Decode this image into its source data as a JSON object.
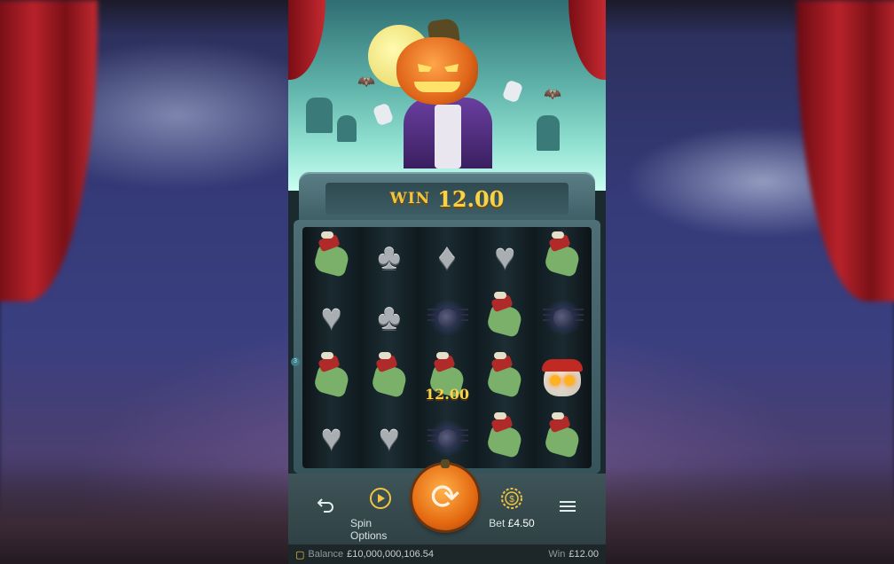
{
  "hud": {
    "win_label": "WIN",
    "win_amount": "12.00"
  },
  "reels": {
    "rows": [
      [
        "zombie-hand",
        "club",
        "diamond",
        "heart",
        "zombie-hand"
      ],
      [
        "heart",
        "club",
        "spider",
        "zombie-hand",
        "spider"
      ],
      [
        "zombie-hand",
        "zombie-hand",
        "zombie-hand",
        "zombie-hand",
        "skull"
      ],
      [
        "heart",
        "heart",
        "spider",
        "zombie-hand",
        "zombie-hand"
      ]
    ],
    "win_payout": "12.00",
    "payline_number": "3"
  },
  "controls": {
    "spin_options_label": "Spin Options",
    "bet_label": "Bet",
    "bet_value": "£4.50"
  },
  "status": {
    "balance_label": "Balance",
    "balance_value": "£10,000,000,106.54",
    "win_label": "Win",
    "win_value": "£12.00"
  },
  "colors": {
    "win_gold": "#f7d24a",
    "spin_orange": "#e56a12",
    "panel_teal": "#3e5458"
  }
}
